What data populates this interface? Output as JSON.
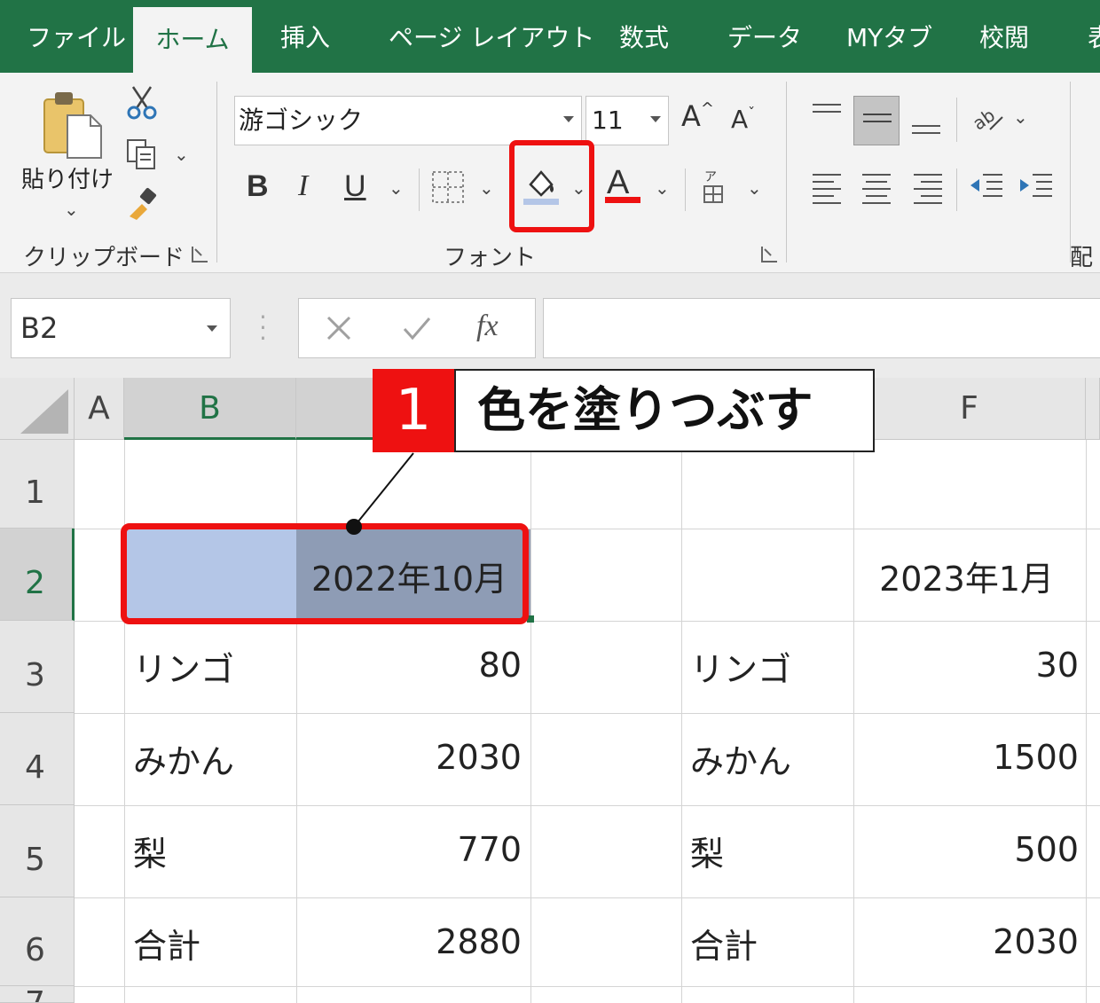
{
  "tabs": [
    "ファイル",
    "ホーム",
    "挿入",
    "ページ レイアウト",
    "数式",
    "データ",
    "MYタブ",
    "校閲",
    "表"
  ],
  "active_tab": "ホーム",
  "clipboard": {
    "paste_label": "貼り付け",
    "group_label": "クリップボード"
  },
  "font": {
    "name": "游ゴシック",
    "size": "11",
    "group_label": "フォント",
    "bold": "B",
    "italic": "I",
    "underline": "U",
    "grow": "A",
    "shrink": "A",
    "font_color_letter": "A"
  },
  "alignment": {
    "group_label": "配"
  },
  "formula_bar": {
    "name_box": "B2",
    "fx": "fx"
  },
  "columns": [
    "A",
    "B",
    "F"
  ],
  "rows": [
    "1",
    "2",
    "3",
    "4",
    "5",
    "6",
    "7"
  ],
  "table_left": {
    "header": "2022年10月",
    "items": [
      {
        "label": "リンゴ",
        "value": "80"
      },
      {
        "label": "みかん",
        "value": "2030"
      },
      {
        "label": "梨",
        "value": "770"
      },
      {
        "label": "合計",
        "value": "2880"
      }
    ]
  },
  "table_right": {
    "header": "2023年1月",
    "items": [
      {
        "label": "リンゴ",
        "value": "30"
      },
      {
        "label": "みかん",
        "value": "1500"
      },
      {
        "label": "梨",
        "value": "500"
      },
      {
        "label": "合計",
        "value": "2030"
      }
    ]
  },
  "callout": {
    "number": "1",
    "text": "色を塗りつぶす"
  },
  "colors": {
    "excel_green": "#217346",
    "highlight_red": "#ee1111",
    "fill_light": "#b4c6e7",
    "fill_selected": "#8e9cb5"
  }
}
